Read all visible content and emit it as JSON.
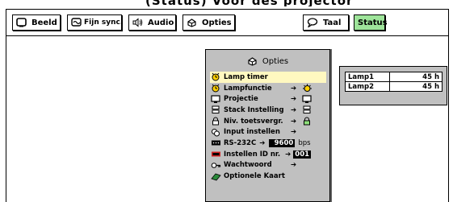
{
  "top_bar": {
    "cut_title": "(Status) Voor des projector"
  },
  "toolbar": {
    "tabs": [
      {
        "label": "Beeld",
        "icon": "picture-icon"
      },
      {
        "label": "Fijn sync.",
        "icon": "fine-sync-icon"
      },
      {
        "label": "Audio",
        "icon": "speaker-icon"
      },
      {
        "label": "Opties",
        "icon": "options-icon"
      }
    ],
    "language": {
      "label": "Taal",
      "icon": "speech-bubble-icon"
    },
    "status": {
      "label": "Status",
      "color": "#9ee49a"
    }
  },
  "menu": {
    "title": "Opties",
    "items": [
      {
        "label": "Lamp timer",
        "icon": "lamp-timer-icon",
        "selected": true
      },
      {
        "label": "Lampfunctie",
        "arrow": "➔",
        "right_icon": "lamp-function-icon"
      },
      {
        "label": "Projectie",
        "arrow": "➔",
        "right_icon": "projection-icon"
      },
      {
        "label": "Stack Instelling",
        "arrow": "➔",
        "right_icon": "stack-icon"
      },
      {
        "label": "Niv. toetsvergr.",
        "arrow": "➔",
        "right_icon": "lock-icon"
      },
      {
        "label": "Input instellen",
        "arrow": "➔"
      },
      {
        "label": "RS-232C",
        "arrow": "➔",
        "value": "9600",
        "unit": "bps"
      },
      {
        "label": "Instellen ID nr.",
        "arrow": "➔",
        "value": "001"
      },
      {
        "label": "Wachtwoord",
        "arrow": "➔"
      },
      {
        "label": "Optionele Kaart"
      }
    ]
  },
  "lamp_panel": {
    "rows": [
      {
        "name": "Lamp1",
        "value": "45 h"
      },
      {
        "name": "Lamp2",
        "value": "45 h"
      }
    ]
  }
}
